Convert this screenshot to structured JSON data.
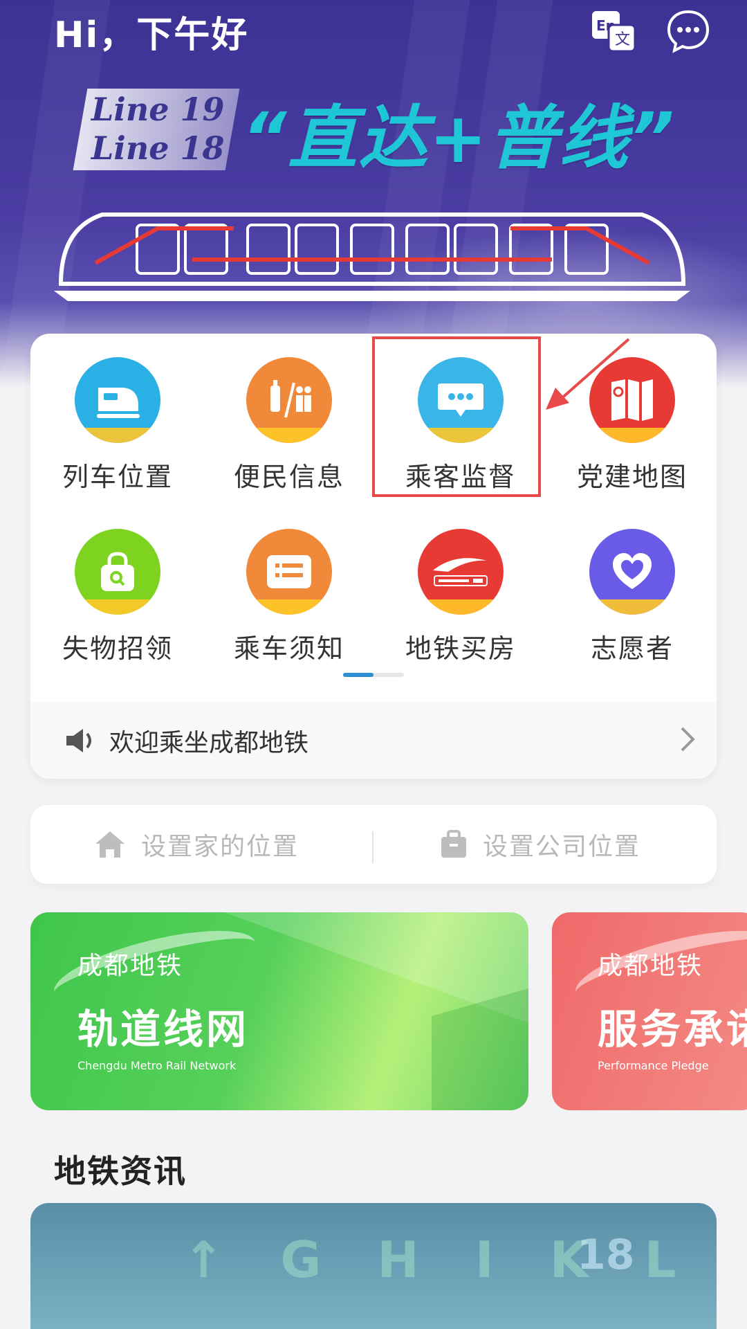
{
  "header": {
    "greeting": "Hi，下午好",
    "translate_icon": "translate-icon",
    "message_icon": "chat-icon"
  },
  "banner": {
    "line_a": "Line 19",
    "line_b": "Line 18",
    "slogan": "“直达+普线”"
  },
  "services": [
    {
      "label": "列车位置",
      "icon": "train-icon",
      "color": "#2bb0e6"
    },
    {
      "label": "便民信息",
      "icon": "convenience-icon",
      "color": "#f08a3a"
    },
    {
      "label": "乘客监督",
      "icon": "chat-bubble-icon",
      "color": "#39b5e8"
    },
    {
      "label": "党建地图",
      "icon": "party-flag-icon",
      "color": "#e83a34"
    },
    {
      "label": "失物招领",
      "icon": "lost-found-icon",
      "color": "#7ed321"
    },
    {
      "label": "乘车须知",
      "icon": "notice-list-icon",
      "color": "#f08a3a"
    },
    {
      "label": "地铁买房",
      "icon": "metro-city-icon",
      "color": "#e83a34"
    },
    {
      "label": "志愿者",
      "icon": "heart-icon",
      "color": "#6a5ae8"
    }
  ],
  "notice": {
    "text": "欢迎乘坐成都地铁"
  },
  "locations": {
    "home": "设置家的位置",
    "work": "设置公司位置"
  },
  "promos": [
    {
      "sub": "成都地铁",
      "main": "轨道线网",
      "en": "Chengdu Metro Rail Network"
    },
    {
      "sub": "成都地铁",
      "main": "服务承诺",
      "en": "Performance Pledge"
    }
  ],
  "news": {
    "title": "地铁资讯"
  },
  "colors": {
    "accent": "#2b8fd1",
    "highlight": "#e84a4a",
    "hero": "#3d3294"
  }
}
